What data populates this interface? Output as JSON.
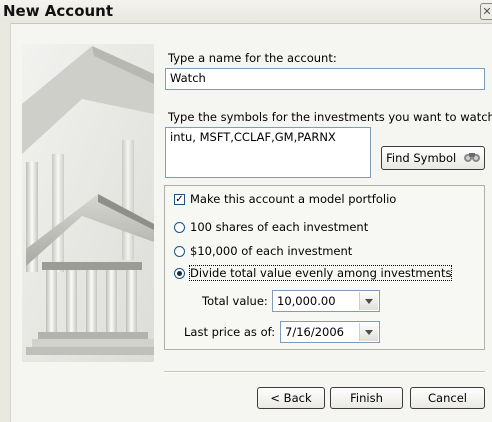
{
  "window": {
    "title": "New Account",
    "close_glyph": "✕"
  },
  "name_field": {
    "label": "Type a name for the account:",
    "value": "Watch"
  },
  "symbols_field": {
    "label": "Type the symbols for the investments you want to watch:",
    "value": "intu, MSFT,CCLAF,GM,PARNX"
  },
  "find_symbol_button": {
    "label": "Find Symbol",
    "icon": "binoculars-icon"
  },
  "model_portfolio": {
    "checkbox_label": "Make this account a model portfolio",
    "checked": true,
    "options": [
      {
        "label": "100 shares of each investment",
        "selected": false
      },
      {
        "label": "$10,000 of each investment",
        "selected": false
      },
      {
        "label": "Divide total value evenly among investments",
        "selected": true
      }
    ],
    "total_value": {
      "label": "Total value:",
      "value": "10,000.00"
    },
    "last_price": {
      "label": "Last price as of:",
      "value": "7/16/2006"
    }
  },
  "buttons": {
    "back": "< Back",
    "finish": "Finish",
    "cancel": "Cancel"
  },
  "colors": {
    "field_border": "#7f9db9",
    "dialog_bg": "#f5f5f2",
    "radio_border": "#1c5180"
  }
}
